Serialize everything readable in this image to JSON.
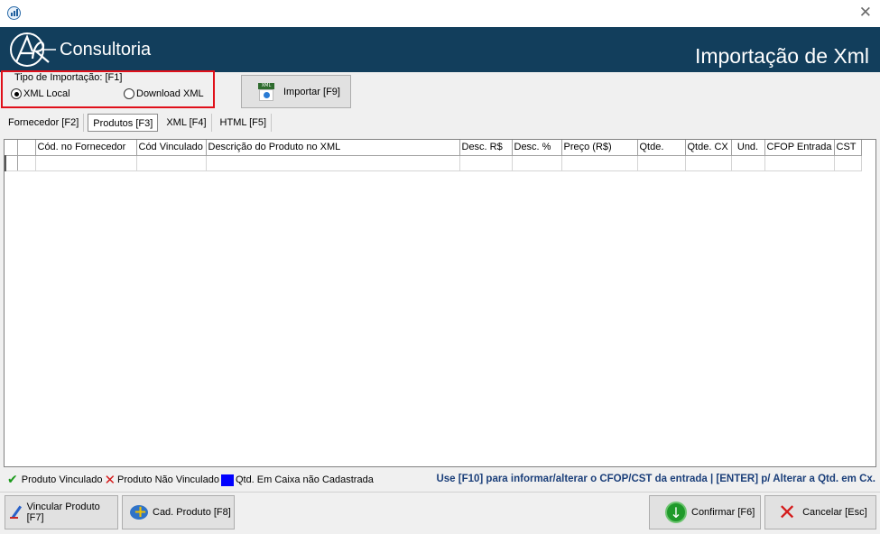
{
  "banner": {
    "brand": "Consultoria",
    "title": "Importação de Xml"
  },
  "import_type": {
    "legend": "Tipo de Importação: [F1]",
    "options": [
      {
        "label": "XML Local",
        "selected": true
      },
      {
        "label": "Download XML",
        "selected": false
      }
    ]
  },
  "toolbar": {
    "importar_label": "Importar [F9]"
  },
  "tabs": [
    {
      "label": "Fornecedor [F2]",
      "active": false
    },
    {
      "label": "Produtos [F3]",
      "active": true
    },
    {
      "label": "XML [F4]",
      "active": false
    },
    {
      "label": "HTML [F5]",
      "active": false
    }
  ],
  "grid": {
    "columns": [
      "",
      "",
      "Cód. no Fornecedor",
      "Cód Vinculado",
      "Descrição do Produto no XML",
      "Desc. R$",
      "Desc. %",
      "Preço (R$)",
      "Qtde.",
      "Qtde. CX",
      "Und.",
      "CFOP Entrada",
      "CST"
    ]
  },
  "legend": {
    "vinculado": "Produto Vinculado",
    "nao_vinculado": "Produto Não Vinculado",
    "caixa": "Qtd. Em Caixa não Cadastrada",
    "hint": "Use [F10] para informar/alterar o CFOP/CST da entrada | [ENTER] p/ Alterar a Qtd. em Cx."
  },
  "buttons": {
    "vincular": "Vincular Produto [F7]",
    "cad": "Cad. Produto [F8]",
    "confirmar": "Confirmar [F6]",
    "cancelar": "Cancelar [Esc]"
  },
  "colors": {
    "banner": "#123e5c",
    "highlight": "#e0101a",
    "hint": "#1b3f7a"
  }
}
